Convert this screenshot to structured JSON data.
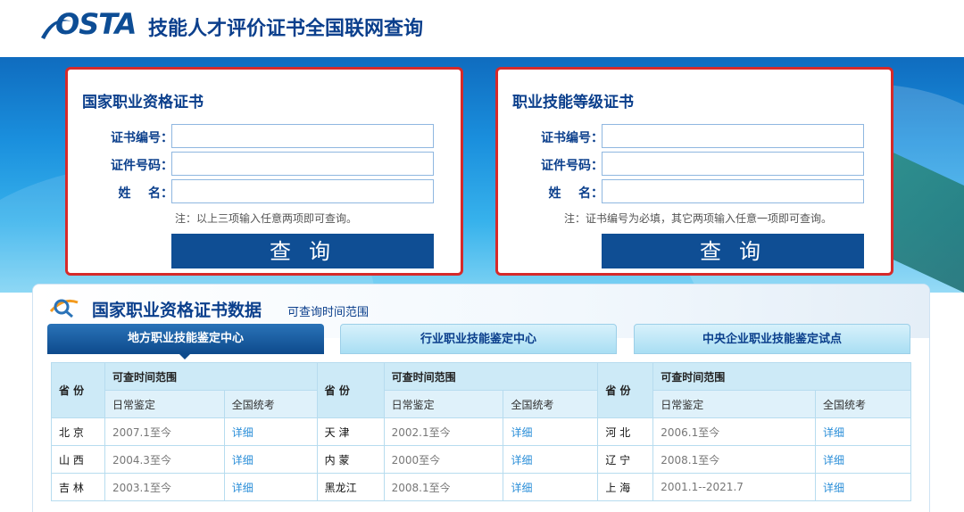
{
  "header": {
    "logo_text": "OSTA",
    "title": "技能人才评价证书全国联网查询"
  },
  "query_left": {
    "title": "国家职业资格证书",
    "cert_no_label": "证书编号：",
    "id_no_label": "证件号码：",
    "name_label": "姓    名：",
    "note": "注：以上三项输入任意两项即可查询。",
    "button": "查询"
  },
  "query_right": {
    "title": "职业技能等级证书",
    "cert_no_label": "证书编号：",
    "id_no_label": "证件号码：",
    "name_label": "姓    名：",
    "note": "注：证书编号为必填，其它两项输入任意一项即可查询。",
    "button": "查询"
  },
  "panel": {
    "title": "国家职业资格证书数据",
    "subtitle": "可查询时间范围"
  },
  "tabs": [
    {
      "label": "地方职业技能鉴定中心",
      "active": true
    },
    {
      "label": "行业职业技能鉴定中心",
      "active": false
    },
    {
      "label": "中央企业职业技能鉴定试点",
      "active": false
    }
  ],
  "table": {
    "province_header": "省 份",
    "range_header": "可查时间范围",
    "daily_header": "日常鉴定",
    "national_header": "全国统考",
    "rows": [
      [
        {
          "province": "北 京",
          "range": "2007.1至今",
          "link": "详细"
        },
        {
          "province": "天 津",
          "range": "2002.1至今",
          "link": "详细"
        },
        {
          "province": "河 北",
          "range": "2006.1至今",
          "link": "详细"
        }
      ],
      [
        {
          "province": "山 西",
          "range": "2004.3至今",
          "link": "详细"
        },
        {
          "province": "内 蒙",
          "range": "2000至今",
          "link": "详细"
        },
        {
          "province": "辽 宁",
          "range": "2008.1至今",
          "link": "详细"
        }
      ],
      [
        {
          "province": "吉 林",
          "range": "2003.1至今",
          "link": "详细"
        },
        {
          "province": "黑龙江",
          "range": "2008.1至今",
          "link": "详细"
        },
        {
          "province": "上 海",
          "range": "2001.1--2021.7",
          "link": "详细"
        }
      ]
    ]
  },
  "colors": {
    "brand_blue": "#0b3f8c",
    "button_blue": "#0f4e94",
    "box_border_red": "#d62a2a",
    "link_blue": "#2a8ed8"
  }
}
